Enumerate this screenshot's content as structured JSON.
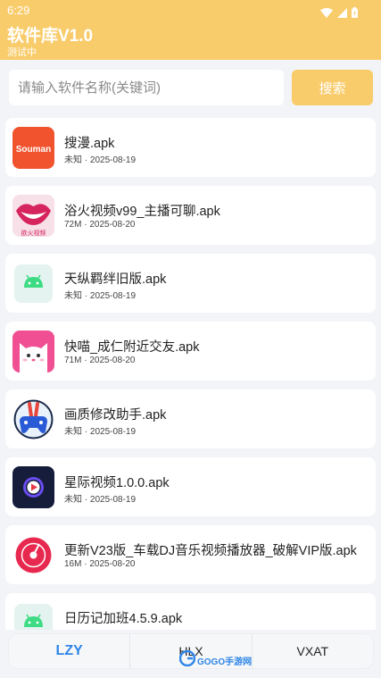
{
  "status_bar": {
    "time": "6:29"
  },
  "header": {
    "title": "软件库V1.0",
    "subtitle": "测试中"
  },
  "search": {
    "placeholder": "请输入软件名称(关键词)",
    "button_label": "搜索"
  },
  "apps": [
    {
      "title": "搜漫.apk",
      "meta": "未知 · 2025-08-19",
      "icon": "souman-logo",
      "icon_text": "Souman"
    },
    {
      "title": "浴火视频v99_主播可聊.apk",
      "meta": "72M · 2025-08-20",
      "icon": "lips-logo",
      "icon_text": "欲火视频"
    },
    {
      "title": "天纵羁绊旧版.apk",
      "meta": "未知 · 2025-08-19",
      "icon": "android-icon"
    },
    {
      "title": "快喵_成仁附近交友.apk",
      "meta": "71M · 2025-08-20",
      "icon": "cat-logo"
    },
    {
      "title": "画质修改助手.apk",
      "meta": "未知 · 2025-08-19",
      "icon": "gamepad-logo"
    },
    {
      "title": "星际视频1.0.0.apk",
      "meta": "未知 · 2025-08-19",
      "icon": "play-logo"
    },
    {
      "title": "更新V23版_车载DJ音乐视频播放器_破解VIP版.apk",
      "meta": "16M · 2025-08-20",
      "icon": "music-disc-logo"
    },
    {
      "title": "日历记加班4.5.9.apk",
      "meta": "",
      "icon": "android-icon"
    }
  ],
  "bottom_nav": {
    "tabs": [
      "LZY",
      "HLX",
      "VXAT"
    ],
    "active_index": 0
  },
  "watermark": {
    "text": "GOGO手游网"
  },
  "colors": {
    "accent": "#f9cc6b",
    "active_tab": "#2f86e8",
    "background": "#f2f4f7"
  }
}
